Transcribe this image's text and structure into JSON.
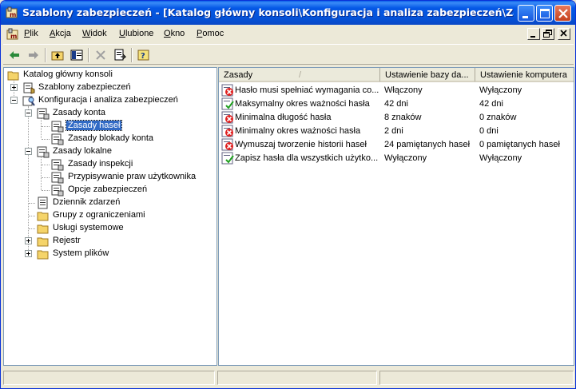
{
  "window": {
    "title": "Szablony zabezpieczeń - [Katalog główny konsoli\\Konfiguracja i analiza zabezpieczeń\\Zasady kon..."
  },
  "menu": {
    "items": [
      {
        "label": "Plik"
      },
      {
        "label": "Akcja"
      },
      {
        "label": "Widok"
      },
      {
        "label": "Ulubione"
      },
      {
        "label": "Okno"
      },
      {
        "label": "Pomoc"
      }
    ]
  },
  "toolbar": {
    "buttons": [
      "back-icon",
      "forward-icon",
      "up-folder-icon",
      "show-hide-tree-icon",
      "delete-icon",
      "export-list-icon",
      "help-icon"
    ]
  },
  "tree": {
    "root": "Katalog główny konsoli",
    "templates": "Szablony zabezpieczeń",
    "analysis": "Konfiguracja i analiza zabezpieczeń",
    "account_policies": "Zasady konta",
    "password_policy": "Zasady haseł",
    "lockout_policy": "Zasady blokady konta",
    "local_policies": "Zasady lokalne",
    "audit_policy": "Zasady inspekcji",
    "user_rights": "Przypisywanie praw użytkownika",
    "security_options": "Opcje zabezpieczeń",
    "event_log": "Dziennik zdarzeń",
    "restricted_groups": "Grupy z ograniczeniami",
    "system_services": "Usługi systemowe",
    "registry": "Rejestr",
    "file_system": "System plików"
  },
  "list": {
    "columns": [
      "Zasady",
      "Ustawienie bazy da...",
      "Ustawienie komputera"
    ],
    "sort_indicator": "/",
    "rows": [
      {
        "icon": "policy-mismatch-icon",
        "policy": "Hasło musi spełniać wymagania co...",
        "db": "Włączony",
        "computer": "Wyłączony"
      },
      {
        "icon": "policy-match-icon",
        "policy": "Maksymalny okres ważności hasła",
        "db": "42 dni",
        "computer": "42 dni"
      },
      {
        "icon": "policy-mismatch-icon",
        "policy": "Minimalna długość hasła",
        "db": "8 znaków",
        "computer": "0 znaków"
      },
      {
        "icon": "policy-mismatch-icon",
        "policy": "Minimalny okres ważności hasła",
        "db": "2 dni",
        "computer": "0 dni"
      },
      {
        "icon": "policy-mismatch-icon",
        "policy": "Wymuszaj tworzenie historii haseł",
        "db": "24 pamiętanych haseł",
        "computer": "0 pamiętanych haseł"
      },
      {
        "icon": "policy-match-icon",
        "policy": "Zapisz hasła dla wszystkich użytko...",
        "db": "Wyłączony",
        "computer": "Wyłączony"
      }
    ]
  },
  "colors": {
    "titlebar": "#0558e6",
    "selection": "#316ac5",
    "mismatch": "#e02020",
    "match": "#20a020"
  }
}
